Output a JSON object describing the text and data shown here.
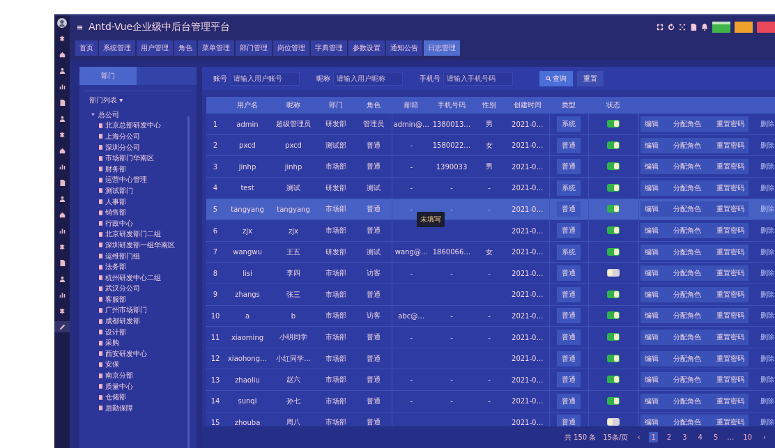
{
  "window": {
    "title": "Antd-Vue企业级中后台管理平台"
  },
  "themes": [
    {
      "color": "#3fb54a",
      "selected": true
    },
    {
      "color": "#f0a12c",
      "selected": false
    },
    {
      "color": "#e8485a",
      "selected": false
    }
  ],
  "nav_items": [
    {
      "selected": false
    },
    {
      "selected": false
    },
    {
      "selected": false
    },
    {
      "selected": false
    },
    {
      "selected": false
    },
    {
      "selected": false
    },
    {
      "selected": false
    },
    {
      "selected": false
    },
    {
      "selected": false
    },
    {
      "selected": false
    },
    {
      "selected": false
    },
    {
      "selected": false
    },
    {
      "selected": false
    },
    {
      "selected": false
    },
    {
      "selected": false
    },
    {
      "selected": false
    },
    {
      "selected": false
    },
    {
      "selected": false
    },
    {
      "selected": true
    }
  ],
  "tabs": [
    {
      "label": "首页",
      "selected": false
    },
    {
      "label": "系统管理",
      "selected": false
    },
    {
      "label": "用户管理",
      "selected": false
    },
    {
      "label": "角色",
      "selected": false
    },
    {
      "label": "菜单管理",
      "selected": false
    },
    {
      "label": "部门管理",
      "selected": false
    },
    {
      "label": "岗位管理",
      "selected": false
    },
    {
      "label": "字典管理",
      "selected": false
    },
    {
      "label": "参数设置",
      "selected": false
    },
    {
      "label": "通知公告",
      "selected": false
    },
    {
      "label": "日志管理",
      "selected": true
    }
  ],
  "tree": {
    "tabs": [
      {
        "label": "部门",
        "selected": true
      }
    ],
    "title": "部门列表 ▾",
    "root": {
      "label": "总公司",
      "expanded": true,
      "children": [
        "北京总部研发中心",
        "上海分公司",
        "深圳分公司",
        "市场部门华南区",
        "财务部",
        "运营中心管理",
        "测试部门",
        "人事部",
        "销售部",
        "行政中心",
        "北京研发部门二组",
        "深圳研发部一组华南区",
        "运维部门组",
        "法务部",
        "杭州研发中心二组",
        "武汉分公司",
        "客服部",
        "广州市场部门",
        "成都研发部",
        "设计部",
        "采购",
        "西安研发中心",
        "安保",
        "南京分部",
        "质量中心",
        "仓储部",
        "后勤保障"
      ]
    }
  },
  "search": {
    "fields": [
      {
        "label": "账号",
        "placeholder": "请输入用户账号"
      },
      {
        "label": "昵称",
        "placeholder": "请输入用户昵称"
      },
      {
        "label": "手机号",
        "placeholder": "请输入手机号码"
      }
    ],
    "buttons": [
      {
        "kind": "primary",
        "label": "查询"
      },
      {
        "kind": "default",
        "label": "重置"
      }
    ]
  },
  "table": {
    "columns": [
      "",
      "用户名",
      "昵称",
      "部门",
      "角色",
      "邮箱",
      "手机号码",
      "性别",
      "创建时间",
      "类型",
      "状态"
    ],
    "rows": [
      {
        "cells": [
          "1",
          "admin",
          "超级管理员",
          "研发部",
          "管理员",
          "admin@…",
          "1380013…",
          "男",
          "2021-0…"
        ],
        "type": "系统",
        "enabled": true,
        "selected": false,
        "actions": [
          "编辑",
          "分配角色",
          "重置密码"
        ],
        "more": "删除"
      },
      {
        "cells": [
          "2",
          "pxcd",
          "pxcd",
          "测试部",
          "普通",
          "-",
          "1580022…",
          "女",
          "2021-0…"
        ],
        "type": "普通",
        "enabled": true,
        "selected": false,
        "actions": [
          "编辑",
          "分配角色",
          "重置密码"
        ],
        "more": "删除"
      },
      {
        "cells": [
          "3",
          "jinhp",
          "jinhp",
          "市场部",
          "普通",
          "-",
          "1390033",
          "男",
          "2021-0…"
        ],
        "type": "普通",
        "enabled": true,
        "selected": false,
        "actions": [
          "编辑",
          "分配角色",
          "重置密码"
        ],
        "more": "删除"
      },
      {
        "cells": [
          "4",
          "test",
          "测试",
          "研发部",
          "测试",
          "-",
          "-",
          "-",
          "2021-0…"
        ],
        "type": "系统",
        "enabled": true,
        "selected": false,
        "actions": [
          "编辑",
          "分配角色",
          "重置密码"
        ],
        "more": "删除"
      },
      {
        "cells": [
          "5",
          "tangyang",
          "tangyang",
          "市场部",
          "普通",
          "-",
          "-",
          "-",
          "2021-0…"
        ],
        "type": "普通",
        "enabled": true,
        "selected": true,
        "actions": [
          "编辑",
          "分配角色",
          "重置密码"
        ],
        "more": "删除"
      },
      {
        "cells": [
          "6",
          "zjx",
          "zjx",
          "市场部",
          "普通",
          null,
          null,
          null,
          "2021-0…"
        ],
        "type": "普通",
        "enabled": true,
        "selected": false,
        "tooltip": "未填写",
        "actions": [
          "编辑",
          "分配角色",
          "重置密码"
        ],
        "more": "删除"
      },
      {
        "cells": [
          "7",
          "wangwu",
          "王五",
          "研发部",
          "测试",
          "wang@…",
          "1860066…",
          "女",
          "2021-0…"
        ],
        "type": "系统",
        "enabled": true,
        "selected": false,
        "actions": [
          "编辑",
          "分配角色",
          "重置密码"
        ],
        "more": "删除"
      },
      {
        "cells": [
          "8",
          "lisi",
          "李四",
          "市场部",
          "访客",
          "-",
          "-",
          "-",
          "2021-0…"
        ],
        "type": "普通",
        "enabled": false,
        "selected": false,
        "actions": [
          "编辑",
          "分配角色",
          "重置密码"
        ],
        "more": "删除"
      },
      {
        "cells": [
          "9",
          "zhangs",
          "张三",
          "市场部",
          "普通",
          null,
          null,
          null,
          "2021-0…"
        ],
        "type": "普通",
        "enabled": true,
        "selected": false,
        "actions": [
          "编辑",
          "分配角色",
          "重置密码"
        ],
        "more": "删除"
      },
      {
        "cells": [
          "10",
          "a",
          "b",
          "市场部",
          "访客",
          "abc@…",
          "-",
          "-",
          "2021-0…"
        ],
        "type": "普通",
        "enabled": true,
        "selected": false,
        "actions": [
          "编辑",
          "分配角色",
          "重置密码"
        ],
        "more": "删除"
      },
      {
        "cells": [
          "11",
          "xiaoming",
          "小明同学",
          "市场部",
          "普通",
          "-",
          "-",
          "-",
          "2021-0…"
        ],
        "type": "普通",
        "enabled": true,
        "selected": false,
        "actions": [
          "编辑",
          "分配角色",
          "重置密码"
        ],
        "more": "删除"
      },
      {
        "cells": [
          "12",
          "xiaohong…",
          "小红同学…",
          "市场部",
          "普通",
          null,
          null,
          null,
          "2021-0…"
        ],
        "type": "普通",
        "enabled": true,
        "selected": false,
        "actions": [
          "编辑",
          "分配角色",
          "重置密码"
        ],
        "more": "删除"
      },
      {
        "cells": [
          "13",
          "zhaoliu",
          "赵六",
          "市场部",
          "普通",
          "-",
          "-",
          "-",
          "2021-0…"
        ],
        "type": "普通",
        "enabled": true,
        "selected": false,
        "actions": [
          "编辑",
          "分配角色",
          "重置密码"
        ],
        "more": "删除"
      },
      {
        "cells": [
          "14",
          "sunqi",
          "孙七",
          "市场部",
          "普通",
          "-",
          "-",
          "-",
          "2021-0…"
        ],
        "type": "普通",
        "enabled": true,
        "selected": false,
        "actions": [
          "编辑",
          "分配角色",
          "重置密码"
        ],
        "more": "删除"
      },
      {
        "cells": [
          "15",
          "zhouba",
          "周八",
          "市场部",
          "普通",
          null,
          null,
          null,
          "2021-0…"
        ],
        "type": "普通",
        "enabled": false,
        "selected": false,
        "actions": [
          "编辑",
          "分配角色",
          "重置密码"
        ],
        "more": "删除"
      }
    ]
  },
  "pagination": {
    "total": "共 150 条",
    "page_size": "15条/页",
    "pages": [
      {
        "label": "1",
        "selected": true
      },
      {
        "label": "2",
        "selected": false
      },
      {
        "label": "3",
        "selected": false
      },
      {
        "label": "4",
        "selected": false
      },
      {
        "label": "5",
        "selected": false
      },
      {
        "label": "10",
        "selected": false
      }
    ],
    "prev": "‹",
    "next": "›",
    "ellipsis": "…"
  }
}
